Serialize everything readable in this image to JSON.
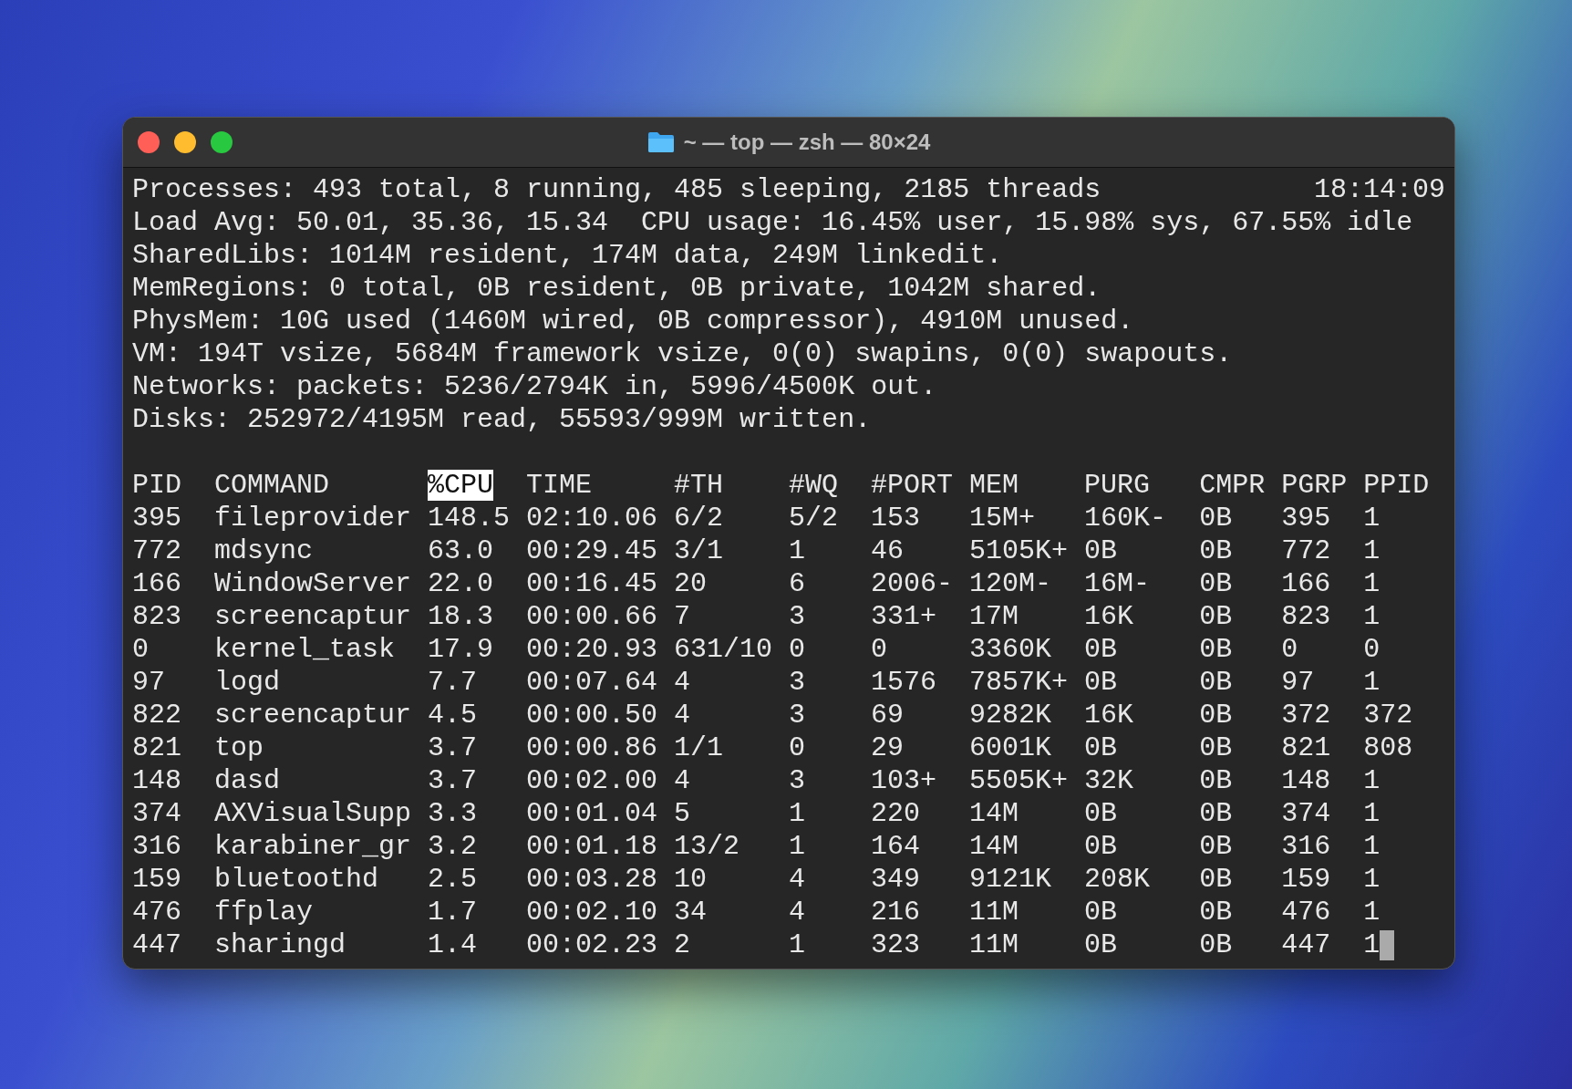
{
  "window": {
    "title": "~ — top — zsh — 80×24"
  },
  "summary": {
    "clock": "18:14:09",
    "lines": [
      "Processes: 493 total, 8 running, 485 sleeping, 2185 threads",
      "Load Avg: 50.01, 35.36, 15.34  CPU usage: 16.45% user, 15.98% sys, 67.55% idle",
      "SharedLibs: 1014M resident, 174M data, 249M linkedit.",
      "MemRegions: 0 total, 0B resident, 0B private, 1042M shared.",
      "PhysMem: 10G used (1460M wired, 0B compressor), 4910M unused.",
      "VM: 194T vsize, 5684M framework vsize, 0(0) swapins, 0(0) swapouts.",
      "Networks: packets: 5236/2794K in, 5996/4500K out.",
      "Disks: 252972/4195M read, 55593/999M written."
    ]
  },
  "table": {
    "columns": [
      {
        "label": "PID",
        "selected": false
      },
      {
        "label": "COMMAND",
        "selected": false
      },
      {
        "label": "%CPU",
        "selected": true
      },
      {
        "label": "TIME",
        "selected": false
      },
      {
        "label": "#TH",
        "selected": false
      },
      {
        "label": "#WQ",
        "selected": false
      },
      {
        "label": "#PORT",
        "selected": false
      },
      {
        "label": "MEM",
        "selected": false
      },
      {
        "label": "PURG",
        "selected": false
      },
      {
        "label": "CMPR",
        "selected": false
      },
      {
        "label": "PGRP",
        "selected": false
      },
      {
        "label": "PPID",
        "selected": false
      }
    ],
    "rows": [
      [
        "395",
        "fileprovider",
        "148.5",
        "02:10.06",
        "6/2",
        "5/2",
        "153",
        "15M+",
        "160K-",
        "0B",
        "395",
        "1"
      ],
      [
        "772",
        "mdsync",
        "63.0",
        "00:29.45",
        "3/1",
        "1",
        "46",
        "5105K+",
        "0B",
        "0B",
        "772",
        "1"
      ],
      [
        "166",
        "WindowServer",
        "22.0",
        "00:16.45",
        "20",
        "6",
        "2006-",
        "120M-",
        "16M-",
        "0B",
        "166",
        "1"
      ],
      [
        "823",
        "screencaptur",
        "18.3",
        "00:00.66",
        "7",
        "3",
        "331+",
        "17M",
        "16K",
        "0B",
        "823",
        "1"
      ],
      [
        "0",
        "kernel_task",
        "17.9",
        "00:20.93",
        "631/10",
        "0",
        "0",
        "3360K",
        "0B",
        "0B",
        "0",
        "0"
      ],
      [
        "97",
        "logd",
        "7.7",
        "00:07.64",
        "4",
        "3",
        "1576",
        "7857K+",
        "0B",
        "0B",
        "97",
        "1"
      ],
      [
        "822",
        "screencaptur",
        "4.5",
        "00:00.50",
        "4",
        "3",
        "69",
        "9282K",
        "16K",
        "0B",
        "372",
        "372"
      ],
      [
        "821",
        "top",
        "3.7",
        "00:00.86",
        "1/1",
        "0",
        "29",
        "6001K",
        "0B",
        "0B",
        "821",
        "808"
      ],
      [
        "148",
        "dasd",
        "3.7",
        "00:02.00",
        "4",
        "3",
        "103+",
        "5505K+",
        "32K",
        "0B",
        "148",
        "1"
      ],
      [
        "374",
        "AXVisualSupp",
        "3.3",
        "00:01.04",
        "5",
        "1",
        "220",
        "14M",
        "0B",
        "0B",
        "374",
        "1"
      ],
      [
        "316",
        "karabiner_gr",
        "3.2",
        "00:01.18",
        "13/2",
        "1",
        "164",
        "14M",
        "0B",
        "0B",
        "316",
        "1"
      ],
      [
        "159",
        "bluetoothd",
        "2.5",
        "00:03.28",
        "10",
        "4",
        "349",
        "9121K",
        "208K",
        "0B",
        "159",
        "1"
      ],
      [
        "476",
        "ffplay",
        "1.7",
        "00:02.10",
        "34",
        "4",
        "216",
        "11M",
        "0B",
        "0B",
        "476",
        "1"
      ],
      [
        "447",
        "sharingd",
        "1.4",
        "00:02.23",
        "2",
        "1",
        "323",
        "11M",
        "0B",
        "0B",
        "447",
        "1"
      ]
    ]
  },
  "cursor": true
}
